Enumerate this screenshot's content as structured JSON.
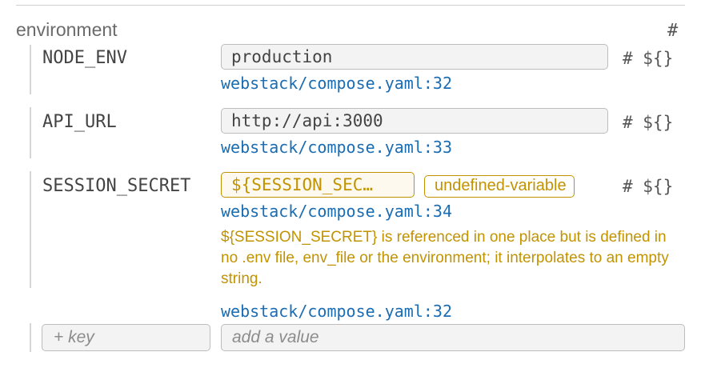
{
  "section": {
    "title": "environment",
    "hash": "#"
  },
  "vars": [
    {
      "key": "NODE_ENV",
      "value": "production",
      "source": "webstack/compose.yaml:32",
      "actions": "# ${}"
    },
    {
      "key": "API_URL",
      "value": "http://api:3000",
      "source": "webstack/compose.yaml:33",
      "actions": "# ${}"
    },
    {
      "key": "SESSION_SECRET",
      "value": "${SESSION_SEC…",
      "source": "webstack/compose.yaml:34",
      "actions": "# ${}",
      "badge": "undefined-variable",
      "warning": "${SESSION_SECRET} is referenced in one place but is defined in no .env file, env_file or the environment; it interpolates to an empty string."
    }
  ],
  "new_entry": {
    "source": "webstack/compose.yaml:32",
    "key_placeholder": "+ key",
    "value_placeholder": "add a value"
  },
  "colors": {
    "link": "#1a6cb3",
    "warning": "#c29300"
  }
}
